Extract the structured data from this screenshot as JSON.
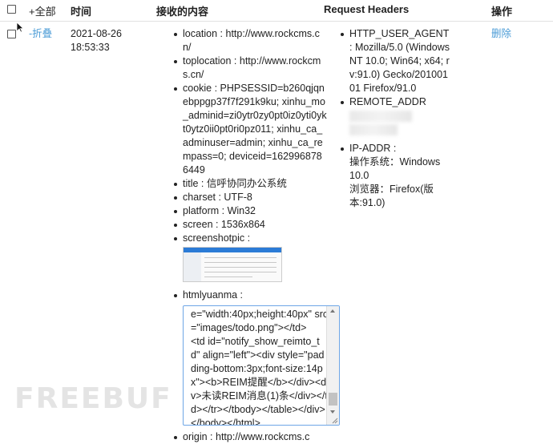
{
  "header": {
    "expand_all": "+全部",
    "col_time": "时间",
    "col_content": "接收的内容",
    "col_headers": "Request Headers",
    "col_action": "操作"
  },
  "row": {
    "collapse": "-折叠",
    "date": "2021-08-26",
    "time": "18:53:33",
    "delete": "删除",
    "content": {
      "location": "location : http://www.rockcms.cn/",
      "toplocation": "toplocation : http://www.rockcms.cn/",
      "cookie": "cookie : PHPSESSID=b260qjqnebppgp37f7f291k9ku; xinhu_mo_adminid=zi0ytr0zy0pt0iz0yti0ykt0ytz0ii0pt0ri0pz011; xinhu_ca_adminuser=admin; xinhu_ca_rempass=0; deviceid=1629968786449",
      "title": "title : 信呼协同办公系统",
      "charset": "charset : UTF-8",
      "platform": "platform : Win32",
      "screen": "screen : 1536x864",
      "screenshotpic": "screenshotpic :",
      "htmlyuanma": "htmlyuanma :",
      "htmlyuanma_value": "e=\"width:40px;height:40px\" src=\"images/todo.png\"></td>\n<td id=\"notify_show_reimto_td\" align=\"left\"><div style=\"padding-bottom:3px;font-size:14px\"><b>REIM提醒</b></div><div>未读REIM消息(1)条</div></td></tr></tbody></table></div></body></html>",
      "origin": "origin : http://www.rockcms.c"
    },
    "headers": {
      "user_agent": "HTTP_USER_AGENT : Mozilla/5.0 (Windows NT 10.0; Win64; x64; rv:91.0) Gecko/20100101 Firefox/91.0",
      "remote_addr": "REMOTE_ADDR",
      "ip_addr": "IP-ADDR :",
      "os": "操作系统：Windows 10.0",
      "browser": "浏览器：Firefox(版本:91.0)"
    }
  },
  "watermark": "FREEBUF"
}
